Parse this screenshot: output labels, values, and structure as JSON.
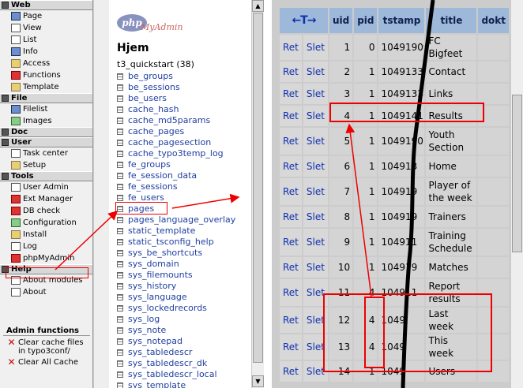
{
  "left_menu": {
    "sections": [
      {
        "title": "Web",
        "items": [
          {
            "label": "Page",
            "icon": "page-icon"
          },
          {
            "label": "View",
            "icon": "view-icon"
          },
          {
            "label": "List",
            "icon": "list-icon"
          },
          {
            "label": "Info",
            "icon": "info-icon"
          },
          {
            "label": "Access",
            "icon": "access-icon"
          },
          {
            "label": "Functions",
            "icon": "functions-icon"
          },
          {
            "label": "Template",
            "icon": "template-icon"
          }
        ]
      },
      {
        "title": "File",
        "items": [
          {
            "label": "Filelist",
            "icon": "filelist-icon"
          },
          {
            "label": "Images",
            "icon": "images-icon"
          }
        ]
      },
      {
        "title": "Doc",
        "items": []
      },
      {
        "title": "User",
        "items": [
          {
            "label": "Task center",
            "icon": "task-center-icon"
          },
          {
            "label": "Setup",
            "icon": "setup-icon"
          }
        ]
      },
      {
        "title": "Tools",
        "items": [
          {
            "label": "User Admin",
            "icon": "user-admin-icon"
          },
          {
            "label": "Ext Manager",
            "icon": "ext-manager-icon"
          },
          {
            "label": "DB check",
            "icon": "db-check-icon"
          },
          {
            "label": "Configuration",
            "icon": "configuration-icon"
          },
          {
            "label": "Install",
            "icon": "install-icon"
          },
          {
            "label": "Log",
            "icon": "log-icon"
          },
          {
            "label": "phpMyAdmin",
            "icon": "phpmyadmin-icon"
          }
        ]
      },
      {
        "title": "Help",
        "items": [
          {
            "label": "About modules",
            "icon": "about-modules-icon"
          },
          {
            "label": "About",
            "icon": "about-icon"
          }
        ]
      }
    ],
    "admin_functions": {
      "title": "Admin functions",
      "items": [
        {
          "label": "Clear cache files in typo3conf/",
          "icon": "clear-cache-icon"
        },
        {
          "label": "Clear All Cache",
          "icon": "clear-all-cache-icon"
        }
      ]
    }
  },
  "nav": {
    "logo_php": "php",
    "logo_myadmin": "MyAdmin",
    "db_title": "Hjem",
    "db_name": "t3_quickstart",
    "db_count": "(38)",
    "tables": [
      "be_groups",
      "be_sessions",
      "be_users",
      "cache_hash",
      "cache_md5params",
      "cache_pages",
      "cache_pagesection",
      "cache_typo3temp_log",
      "fe_groups",
      "fe_session_data",
      "fe_sessions",
      "fe_users",
      "pages",
      "pages_language_overlay",
      "static_template",
      "static_tsconfig_help",
      "sys_be_shortcuts",
      "sys_domain",
      "sys_filemounts",
      "sys_history",
      "sys_language",
      "sys_lockedrecords",
      "sys_log",
      "sys_note",
      "sys_notepad",
      "sys_tabledescr",
      "sys_tabledescr_dk",
      "sys_tabledescr_local",
      "sys_template"
    ]
  },
  "browse": {
    "sort_arrows": "←T→",
    "columns": [
      "uid",
      "pid",
      "tstamp",
      "title",
      "dokt"
    ],
    "edit_label": "Ret",
    "delete_label": "Slet",
    "rows": [
      {
        "uid": "1",
        "pid": "0",
        "tstamp": "10491909",
        "title": "FC Bigfeet"
      },
      {
        "uid": "2",
        "pid": "1",
        "tstamp": "10491338",
        "title": "Contact"
      },
      {
        "uid": "3",
        "pid": "1",
        "tstamp": "10491338",
        "title": "Links"
      },
      {
        "uid": "4",
        "pid": "1",
        "tstamp": "1049141",
        "title": "Results"
      },
      {
        "uid": "5",
        "pid": "1",
        "tstamp": "1049190",
        "title": "Youth Section"
      },
      {
        "uid": "6",
        "pid": "1",
        "tstamp": "104913",
        "title": "Home"
      },
      {
        "uid": "7",
        "pid": "1",
        "tstamp": "104919",
        "title": "Player of the week"
      },
      {
        "uid": "8",
        "pid": "1",
        "tstamp": "104919",
        "title": "Trainers"
      },
      {
        "uid": "9",
        "pid": "1",
        "tstamp": "104911",
        "title": "Training Schedule"
      },
      {
        "uid": "10",
        "pid": "1",
        "tstamp": "104919",
        "title": "Matches"
      },
      {
        "uid": "11",
        "pid": "4",
        "tstamp": "104911",
        "title": "Report results"
      },
      {
        "uid": "12",
        "pid": "4",
        "tstamp": "1049",
        "title": "Last week"
      },
      {
        "uid": "13",
        "pid": "4",
        "tstamp": "1049",
        "title": "This week"
      },
      {
        "uid": "14",
        "pid": "1",
        "tstamp": "1049",
        "title": "Users"
      }
    ]
  },
  "colors": {
    "annotation_red": "#ee0000",
    "header_blue": "#9db8d8",
    "link_blue": "#1030b0"
  }
}
